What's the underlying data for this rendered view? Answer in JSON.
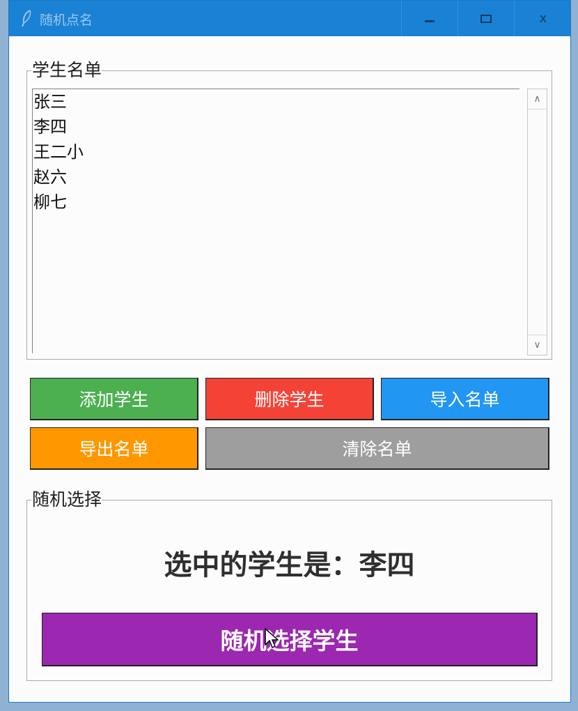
{
  "window": {
    "title": "随机点名",
    "minimize_icon": "minimize-icon",
    "maximize_icon": "maximize-icon",
    "close_label": "x"
  },
  "student_list": {
    "legend": "学生名单",
    "items": [
      "张三",
      "李四",
      "王二小",
      "赵六",
      "柳七"
    ]
  },
  "buttons": {
    "add": {
      "label": "添加学生",
      "color": "#4caf50"
    },
    "delete": {
      "label": "删除学生",
      "color": "#f44336"
    },
    "import": {
      "label": "导入名单",
      "color": "#2196f3"
    },
    "export": {
      "label": "导出名单",
      "color": "#ff9800"
    },
    "clear": {
      "label": "清除名单",
      "color": "#9e9e9e"
    }
  },
  "random_select": {
    "legend": "随机选择",
    "result": "选中的学生是：李四",
    "button_label": "随机选择学生",
    "button_color": "#9c27b0"
  }
}
